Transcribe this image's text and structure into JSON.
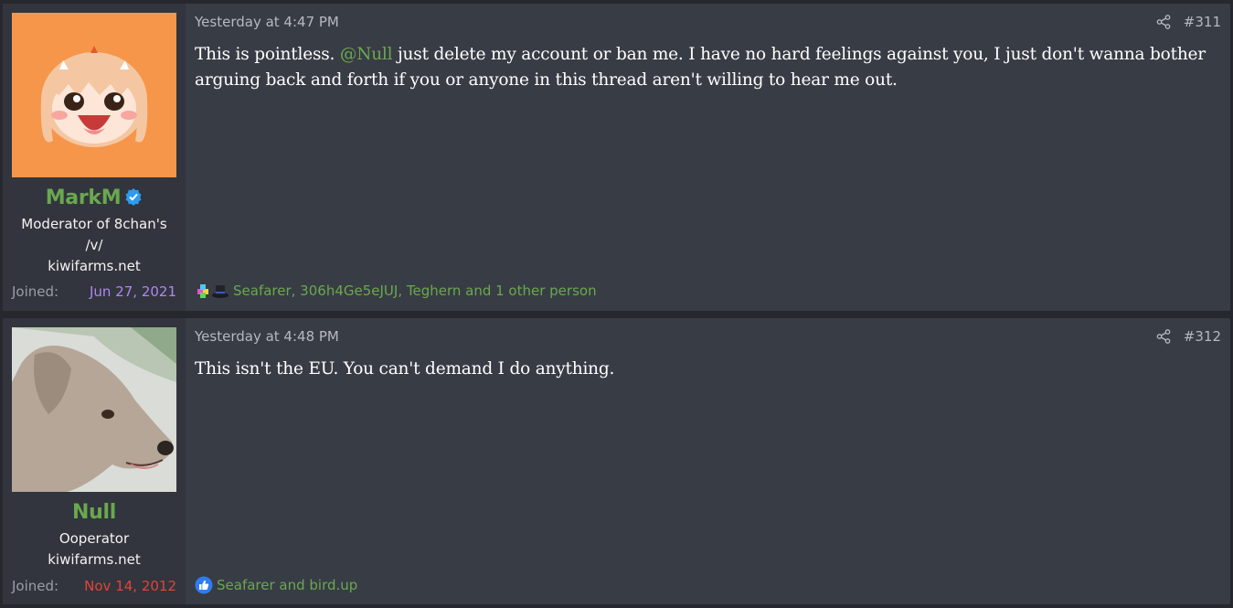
{
  "posts": [
    {
      "author": {
        "name": "MarkM",
        "verified": true,
        "title_line1": "Moderator of 8chan's",
        "title_line2": "/v/",
        "site": "kiwifarms.net",
        "joined_label": "Joined:",
        "joined_date": "Jun 27, 2021",
        "joined_color": "#b085f5",
        "avatar_icon": "orange-anime-girl-avatar"
      },
      "date": "Yesterday at 4:47 PM",
      "number": "#311",
      "message": {
        "before": "This is pointless. ",
        "mention": "@Null",
        "after": " just delete my account or ban me. I have no hard feelings against you, I just don't wanna bother arguing back and forth if you or anyone in this thread aren't willing to hear me out."
      },
      "reactions": {
        "icons": [
          "puzzle-reaction-icon",
          "hat-reaction-icon"
        ],
        "text": "Seafarer, 306h4Ge5eJUJ, Teghern and 1 other person"
      }
    },
    {
      "author": {
        "name": "Null",
        "verified": false,
        "title_line1": "Ooperator",
        "site": "kiwifarms.net",
        "joined_label": "Joined:",
        "joined_date": "Nov 14, 2012",
        "joined_color": "#e0443a",
        "avatar_icon": "dog-avatar"
      },
      "date": "Yesterday at 4:48 PM",
      "number": "#312",
      "message": {
        "text": "This isn't the EU. You can't demand I do anything."
      },
      "reactions": {
        "icons": [
          "like-reaction-icon"
        ],
        "text": "Seafarer and bird.up"
      }
    }
  ],
  "colors": {
    "accent_green": "#6aa84f",
    "post_bg": "#383c45",
    "user_bg": "#32353d",
    "page_bg": "#26282d"
  }
}
